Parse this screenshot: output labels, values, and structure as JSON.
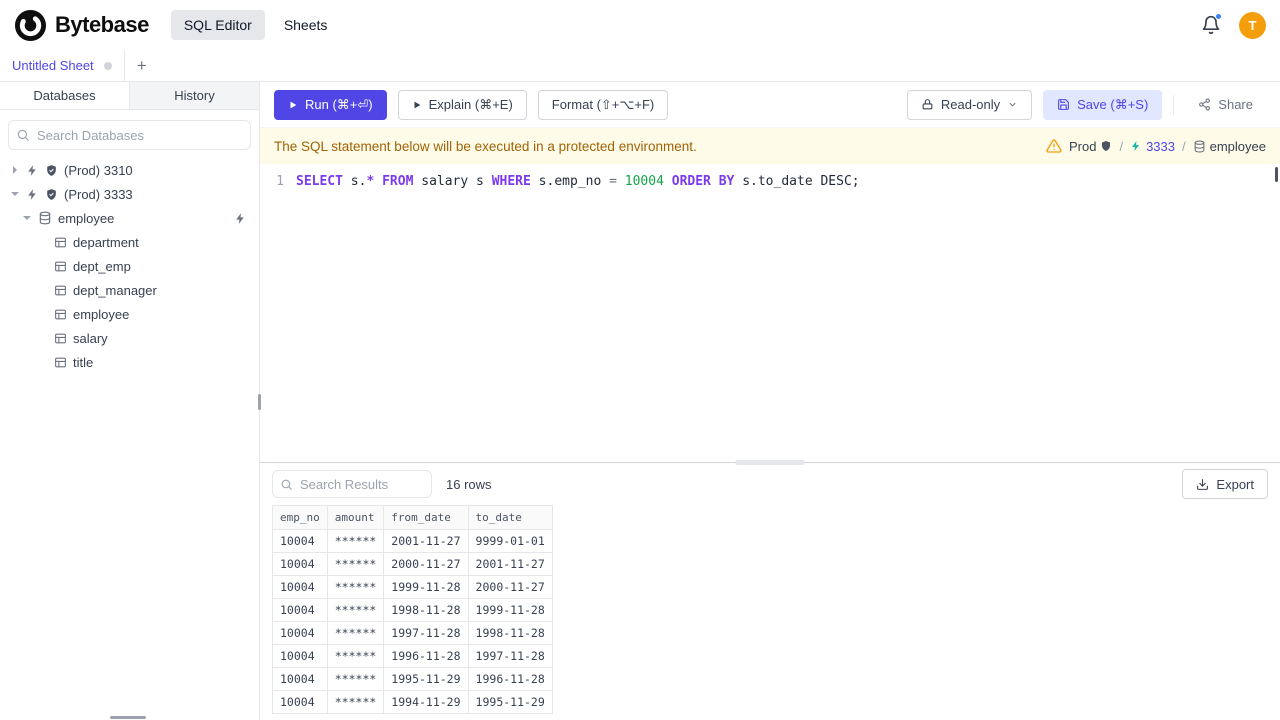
{
  "topbar": {
    "brand": "Bytebase",
    "nav": [
      {
        "label": "SQL Editor",
        "active": true
      },
      {
        "label": "Sheets",
        "active": false
      }
    ],
    "avatar_letter": "T"
  },
  "sheet_tabs": {
    "active_tab": "Untitled Sheet",
    "add_button": "+"
  },
  "sidebar": {
    "tabs": [
      {
        "label": "Databases",
        "active": true
      },
      {
        "label": "History",
        "active": false
      }
    ],
    "search_placeholder": "Search Databases",
    "tree": {
      "instances": [
        {
          "label": "(Prod) 3310",
          "expanded": false
        },
        {
          "label": "(Prod) 3333",
          "expanded": true
        }
      ],
      "database": {
        "label": "employee"
      },
      "tables": [
        "department",
        "dept_emp",
        "dept_manager",
        "employee",
        "salary",
        "title"
      ]
    }
  },
  "toolbar": {
    "run": "Run (⌘+⏎)",
    "explain": "Explain (⌘+E)",
    "format": "Format (⇧+⌥+F)",
    "readonly": "Read-only",
    "save": "Save (⌘+S)",
    "share": "Share"
  },
  "notice": {
    "message": "The SQL statement below will be executed in a protected environment.",
    "breadcrumb": {
      "environment": "Prod",
      "separator": "/",
      "instance": "3333",
      "database": "employee"
    }
  },
  "editor": {
    "line_number": "1",
    "sql_text": "SELECT s.* FROM salary s WHERE s.emp_no = 10004 ORDER BY s.to_date DESC;",
    "tokens": [
      {
        "t": "SELECT",
        "c": "keyword"
      },
      {
        "t": " s.",
        "c": "plain"
      },
      {
        "t": "*",
        "c": "keyword"
      },
      {
        "t": " ",
        "c": "plain"
      },
      {
        "t": "FROM",
        "c": "keyword"
      },
      {
        "t": " salary s ",
        "c": "plain"
      },
      {
        "t": "WHERE",
        "c": "keyword"
      },
      {
        "t": " s.emp_no ",
        "c": "plain"
      },
      {
        "t": "=",
        "c": "operator"
      },
      {
        "t": " ",
        "c": "plain"
      },
      {
        "t": "10004",
        "c": "number"
      },
      {
        "t": " ",
        "c": "plain"
      },
      {
        "t": "ORDER BY",
        "c": "keyword"
      },
      {
        "t": " s.to_date DESC;",
        "c": "plain"
      }
    ]
  },
  "results": {
    "search_placeholder": "Search Results",
    "row_count": "16 rows",
    "export_label": "Export",
    "columns": [
      "emp_no",
      "amount",
      "from_date",
      "to_date"
    ],
    "rows": [
      [
        "10004",
        "******",
        "2001-11-27",
        "9999-01-01"
      ],
      [
        "10004",
        "******",
        "2000-11-27",
        "2001-11-27"
      ],
      [
        "10004",
        "******",
        "1999-11-28",
        "2000-11-27"
      ],
      [
        "10004",
        "******",
        "1998-11-28",
        "1999-11-28"
      ],
      [
        "10004",
        "******",
        "1997-11-28",
        "1998-11-28"
      ],
      [
        "10004",
        "******",
        "1996-11-28",
        "1997-11-28"
      ],
      [
        "10004",
        "******",
        "1995-11-29",
        "1996-11-28"
      ],
      [
        "10004",
        "******",
        "1994-11-29",
        "1995-11-29"
      ]
    ]
  },
  "colors": {
    "primary": "#4f46e5",
    "primary_light": "#e0e7ff",
    "keyword": "#7c3aed",
    "number": "#16a34a",
    "notice_bg": "#fefce8",
    "notice_text": "#a16207",
    "warning": "#f59e0b",
    "avatar_bg": "#f59e0b"
  }
}
